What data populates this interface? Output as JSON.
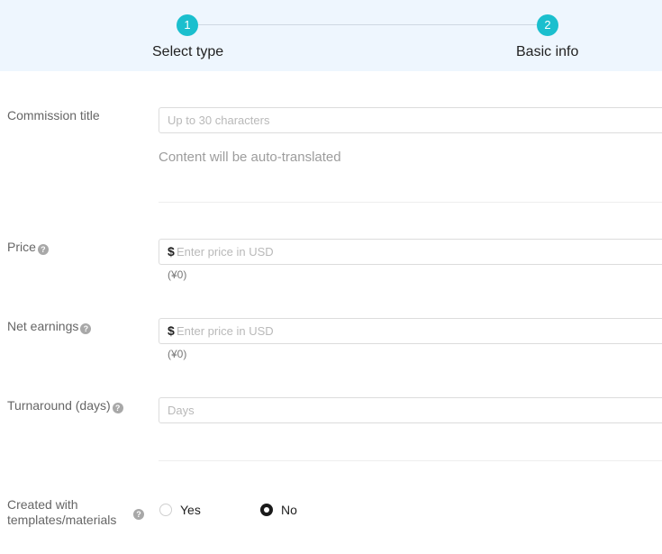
{
  "stepper": {
    "steps": [
      {
        "number": "1",
        "label": "Select type"
      },
      {
        "number": "2",
        "label": "Basic info"
      }
    ]
  },
  "form": {
    "title": {
      "label": "Commission title",
      "placeholder": "Up to 30 characters",
      "hint": "Content will be auto-translated"
    },
    "price": {
      "label": "Price",
      "currency": "$",
      "placeholder": "Enter price in USD",
      "converted": "(¥0)"
    },
    "net": {
      "label": "Net earnings",
      "currency": "$",
      "placeholder": "Enter price in USD",
      "converted": "(¥0)"
    },
    "turnaround": {
      "label": "Turnaround (days)",
      "placeholder": "Days"
    },
    "templates": {
      "label_line1": "Created with",
      "label_line2": "templates/materials",
      "options": [
        {
          "label": "Yes",
          "selected": false
        },
        {
          "label": "No",
          "selected": true
        }
      ]
    },
    "help_glyph": "?"
  }
}
